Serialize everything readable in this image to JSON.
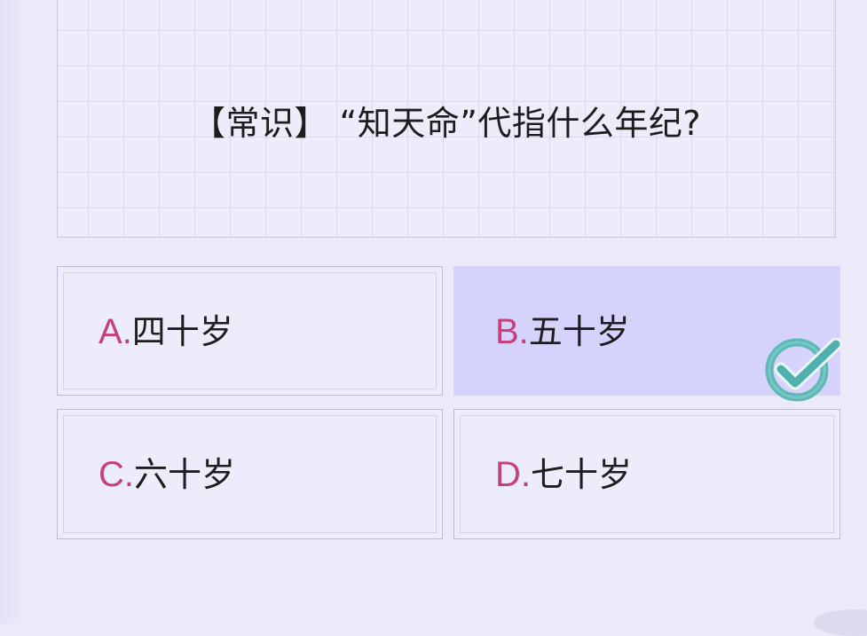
{
  "question": {
    "text": "【常识】 “知天命”代指什么年纪?"
  },
  "options": [
    {
      "letter": "A.",
      "text": "四十岁",
      "selected": false
    },
    {
      "letter": "B.",
      "text": "五十岁",
      "selected": true
    },
    {
      "letter": "C.",
      "text": "六十岁",
      "selected": false
    },
    {
      "letter": "D.",
      "text": "七十岁",
      "selected": false
    }
  ],
  "icons": {
    "correct_mark": "checkmark-icon"
  },
  "colors": {
    "letter_accent": "#c8407a",
    "selected_bg": "#d5d2fb",
    "check_color": "#5db8b6"
  }
}
